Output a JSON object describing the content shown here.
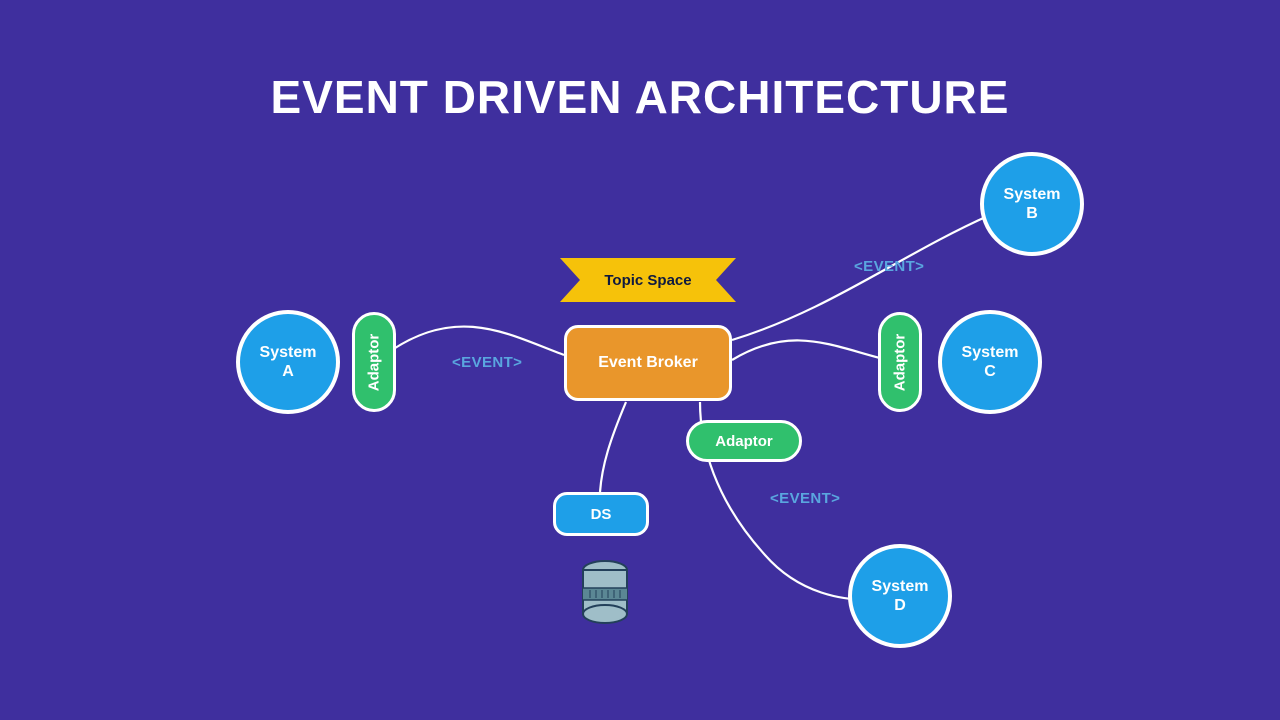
{
  "title": "EVENT DRIVEN ARCHITECTURE",
  "nodes": {
    "systemA": "System\nA",
    "systemB": "System\nB",
    "systemC": "System\nC",
    "systemD": "System\nD",
    "broker": "Event Broker",
    "topicSpace": "Topic Space",
    "ds": "DS"
  },
  "adaptors": {
    "left": "Adaptor",
    "right": "Adaptor",
    "bottom": "Adaptor"
  },
  "eventLabels": {
    "left": "<EVENT>",
    "topRight": "<EVENT>",
    "bottomRight": "<EVENT>"
  },
  "colors": {
    "background": "#3f2f9e",
    "circle": "#1e9fe8",
    "adaptor": "#30c06d",
    "broker": "#e9962b",
    "ribbon": "#f6c20a",
    "outline": "#ffffff",
    "eventText": "#5aa6df"
  }
}
